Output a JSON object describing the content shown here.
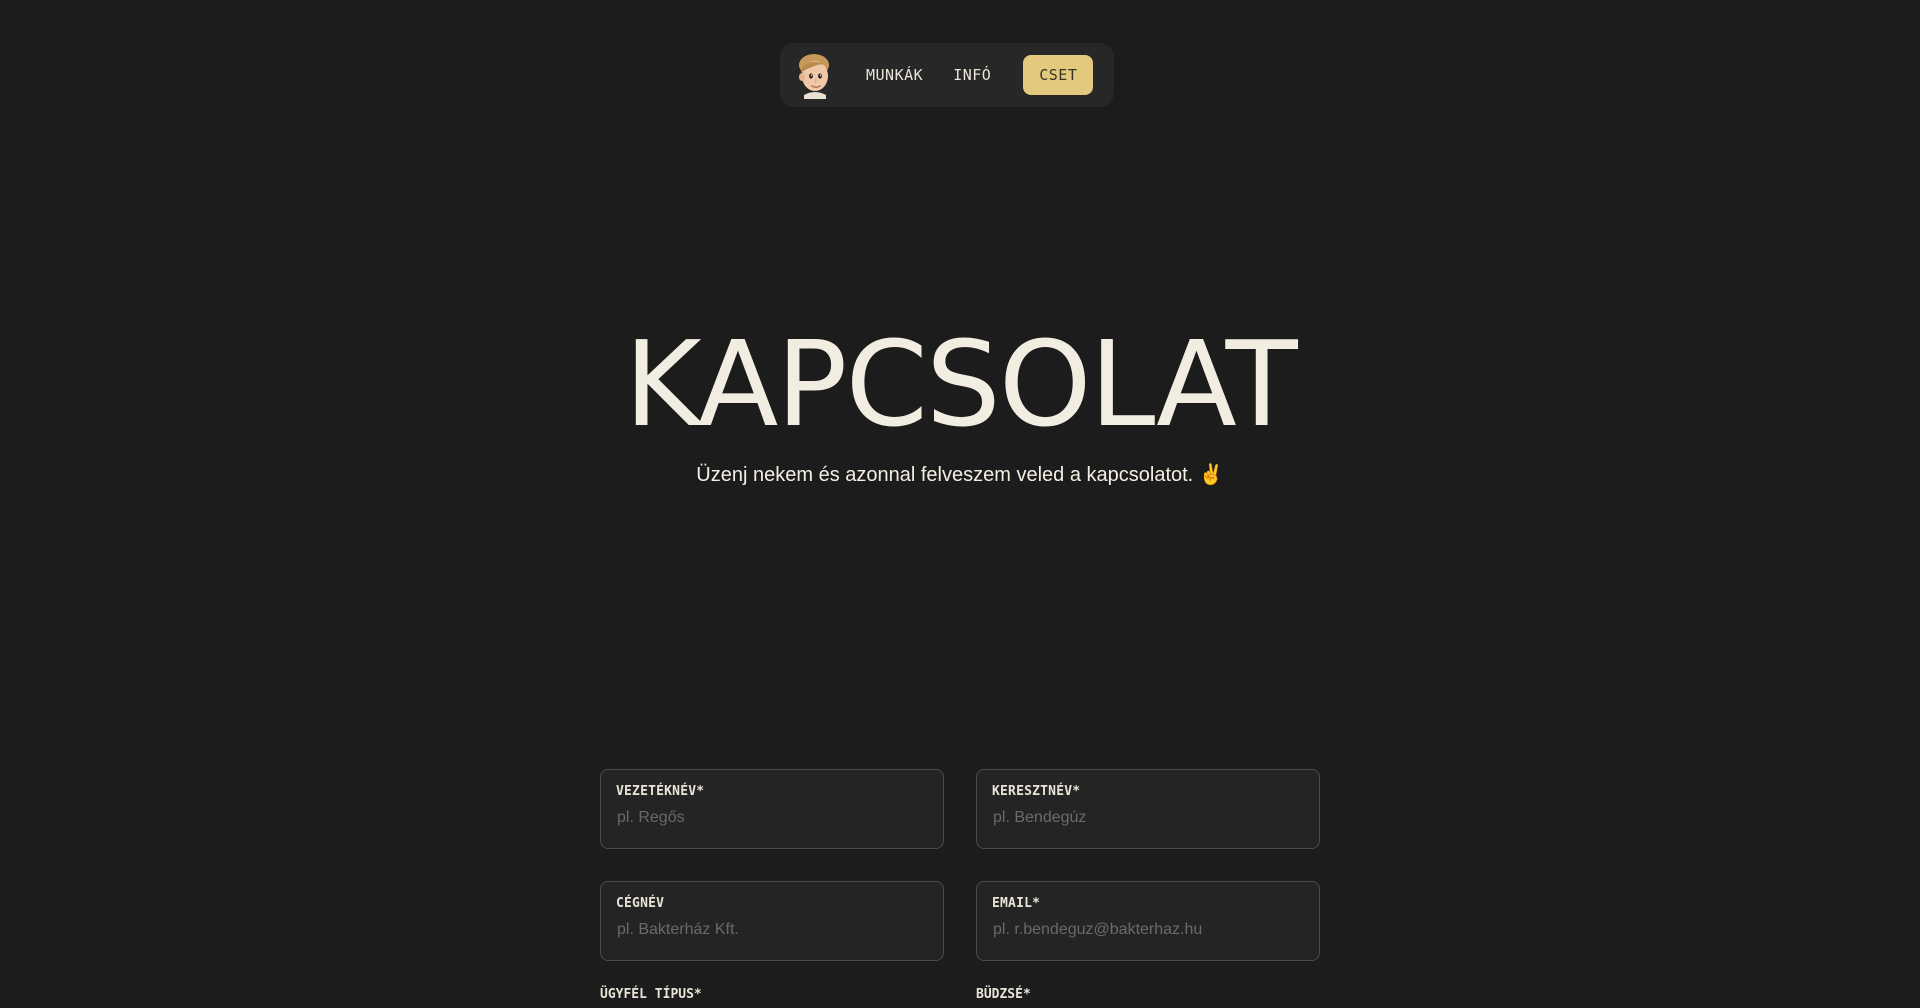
{
  "nav": {
    "avatar_icon": "memoji-avatar-icon",
    "links": [
      {
        "label": "MUNKÁK"
      },
      {
        "label": "INFÓ"
      }
    ],
    "cta_label": "CSET",
    "cta_color": "#e3c97e"
  },
  "hero": {
    "title": "KAPCSOLAT",
    "subtitle": "Üzenj nekem és azonnal felveszem veled a kapcsolatot. ✌️"
  },
  "form": {
    "last_name": {
      "label": "VEZETÉKNÉV*",
      "placeholder": "pl. Regős"
    },
    "first_name": {
      "label": "KERESZTNÉV*",
      "placeholder": "pl. Bendegúz"
    },
    "company": {
      "label": "CÉGNÉV",
      "placeholder": "pl. Bakterház Kft."
    },
    "email": {
      "label": "EMAIL*",
      "placeholder": "pl. r.bendeguz@bakterhaz.hu"
    },
    "client_type": {
      "label": "ÜGYFÉL TÍPUS*"
    },
    "budget": {
      "label": "BÜDZSÉ*"
    }
  },
  "colors": {
    "background": "#1c1c1c",
    "accent": "#e3c97e",
    "text": "#f2ede1"
  }
}
